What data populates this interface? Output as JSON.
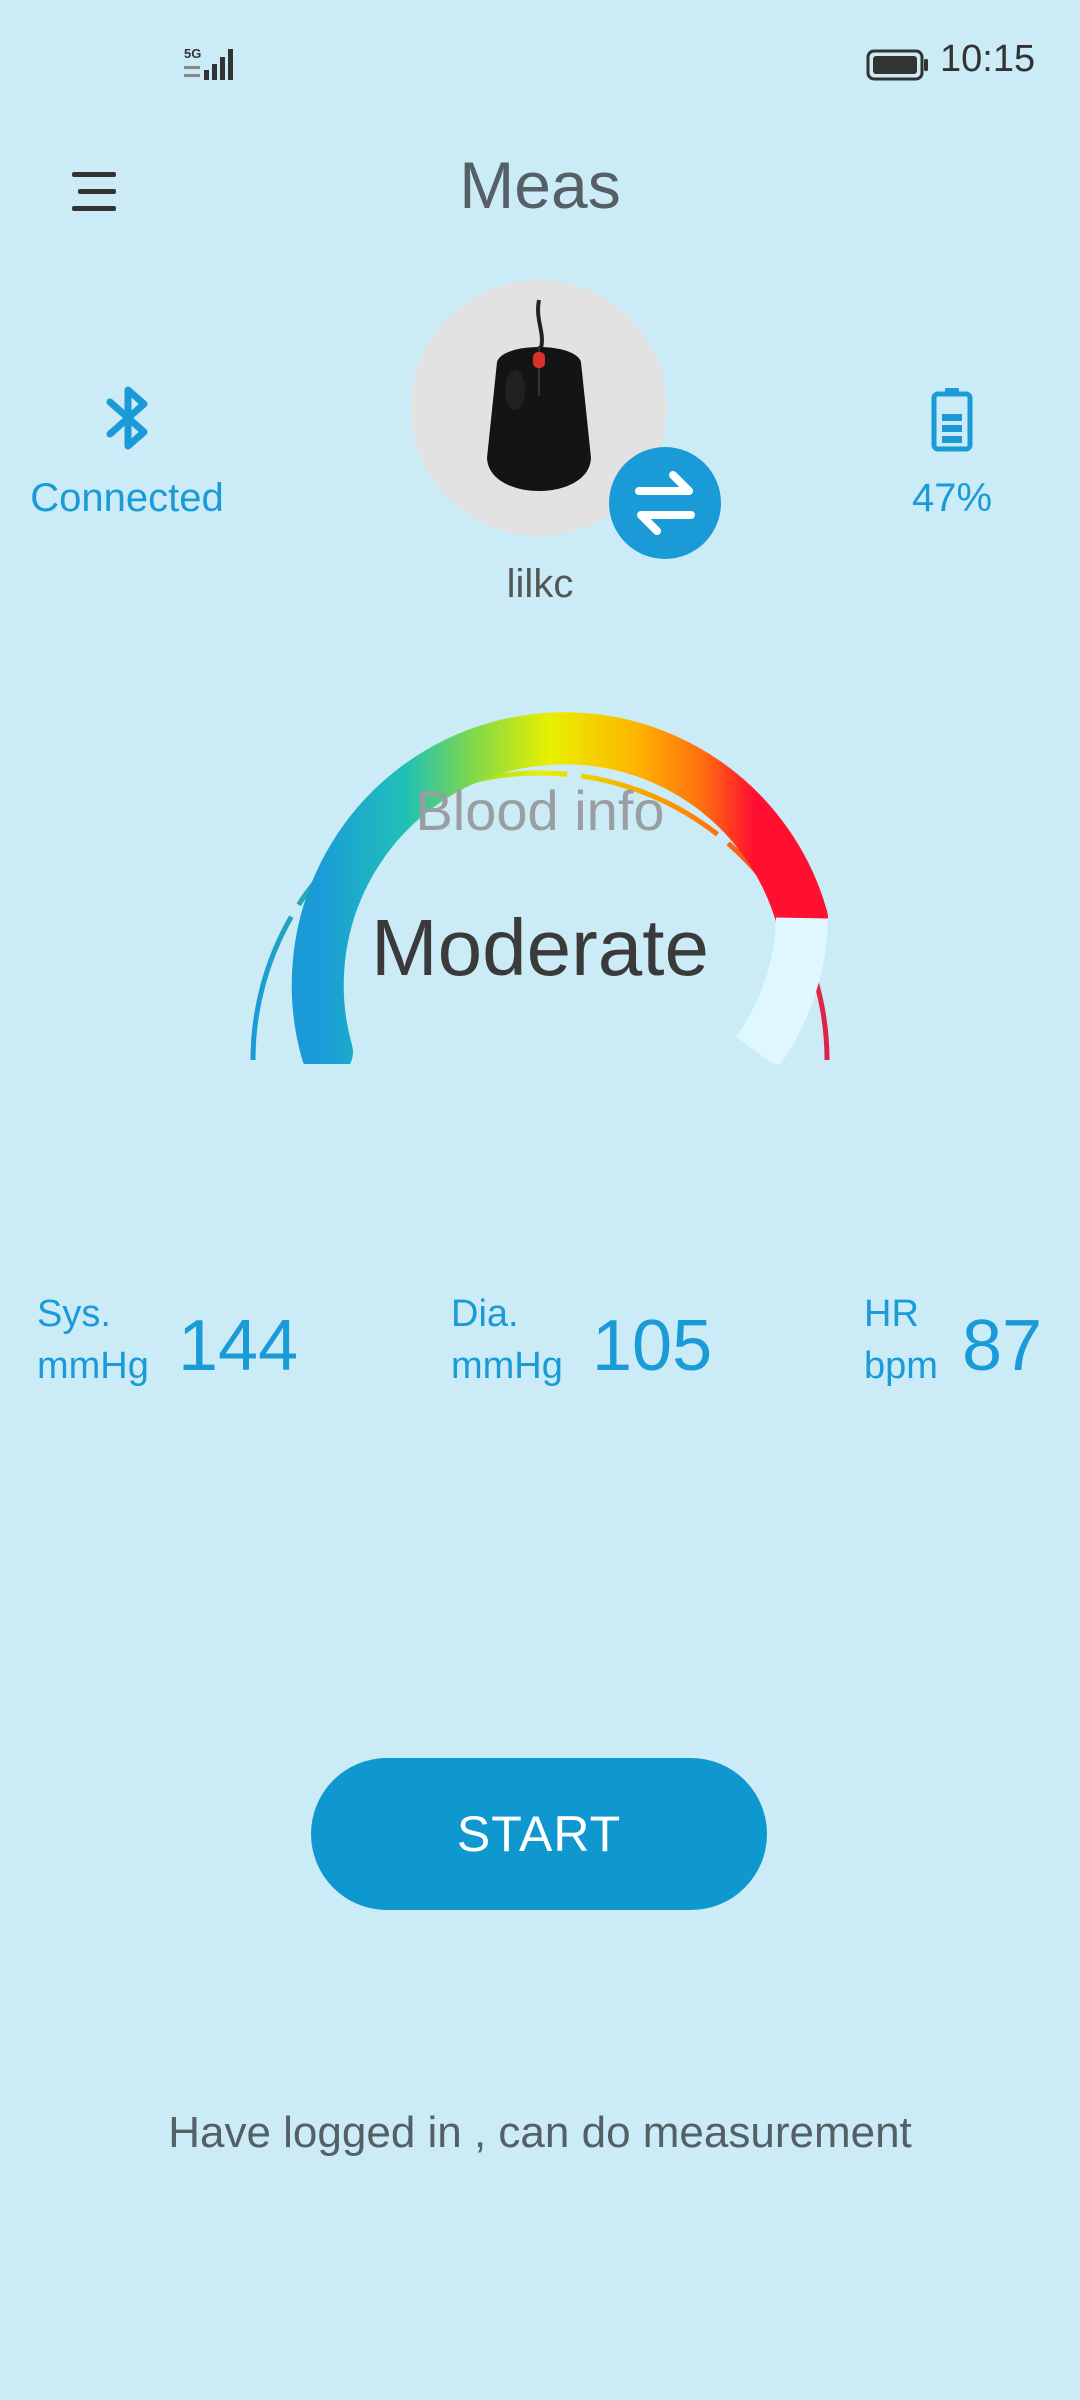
{
  "status": {
    "network": "5G",
    "time": "10:15"
  },
  "header": {
    "title": "Meas",
    "menu_icon": "hamburger-menu-icon"
  },
  "device": {
    "connection_label": "Connected",
    "connection_icon": "bluetooth-icon",
    "battery_label": "47%",
    "battery_icon": "battery-icon",
    "user_name": "lilkc",
    "swap_icon": "swap-arrows-icon"
  },
  "gauge": {
    "title": "Blood info",
    "value": "Moderate"
  },
  "metrics": {
    "sys": {
      "label1": "Sys.",
      "label2": "mmHg",
      "value": "144"
    },
    "dia": {
      "label1": "Dia.",
      "label2": "mmHg",
      "value": "105"
    },
    "hr": {
      "label1": "HR",
      "label2": "bpm",
      "value": "87"
    }
  },
  "action": {
    "start_label": "START"
  },
  "footer": {
    "message": "Have logged in , can do measurement"
  },
  "colors": {
    "accent": "#1a9bd8",
    "background": "#cbecf6",
    "button": "#0f98cf"
  }
}
